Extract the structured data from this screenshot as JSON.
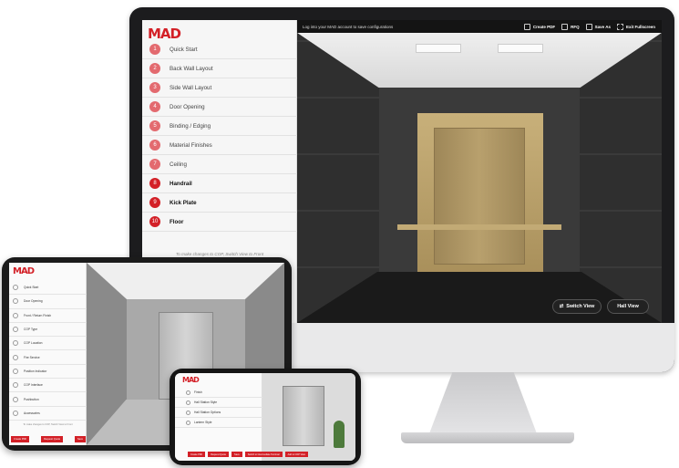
{
  "desktop": {
    "logo": "MAD",
    "menu": [
      {
        "num": "1",
        "label": "Quick Start"
      },
      {
        "num": "2",
        "label": "Back Wall Layout"
      },
      {
        "num": "3",
        "label": "Side Wall Layout"
      },
      {
        "num": "4",
        "label": "Door Opening"
      },
      {
        "num": "5",
        "label": "Binding / Edging"
      },
      {
        "num": "6",
        "label": "Material Finishes"
      },
      {
        "num": "7",
        "label": "Ceiling"
      },
      {
        "num": "8",
        "label": "Handrail"
      },
      {
        "num": "9",
        "label": "Kick Plate"
      },
      {
        "num": "10",
        "label": "Floor"
      }
    ],
    "note": "To make changes to COP, Switch View to Front",
    "login_text": "Log into your MAD account to save configurations",
    "toolbar": {
      "create_pdf": "Create PDF",
      "rfq": "RFQ",
      "save_as": "Save As",
      "exit_fullscreen": "Exit Fullscreen"
    },
    "switch_view": "Switch View",
    "hall_view": "Hall View"
  },
  "tablet": {
    "logo": "MAD",
    "menu": [
      {
        "label": "Quick Start"
      },
      {
        "label": "Door Opening"
      },
      {
        "label": "Front / Return Finish"
      },
      {
        "label": "COP Type"
      },
      {
        "label": "COP Location"
      },
      {
        "label": "Fire Service"
      },
      {
        "label": "Position Indicator"
      },
      {
        "label": "COP Interface"
      },
      {
        "label": "Pushbutton"
      },
      {
        "label": "Accessories"
      }
    ],
    "note": "To make changes to COP, Switch View to Front",
    "buttons": {
      "create_pdf": "Create PDF",
      "request_quote": "Request Quote",
      "save": "Save"
    }
  },
  "phone": {
    "logo": "MAD",
    "menu": [
      {
        "label": "Finish"
      },
      {
        "label": "Hall Station Style"
      },
      {
        "label": "Hall Station Options"
      },
      {
        "label": "Lantern Style"
      }
    ],
    "buttons": {
      "create_pdf": "Create PDF",
      "request_quote": "Request Quote",
      "save": "Save",
      "switch_view": "Switch to Intermediate Terminal",
      "add_cop": "Add to COP View"
    }
  }
}
